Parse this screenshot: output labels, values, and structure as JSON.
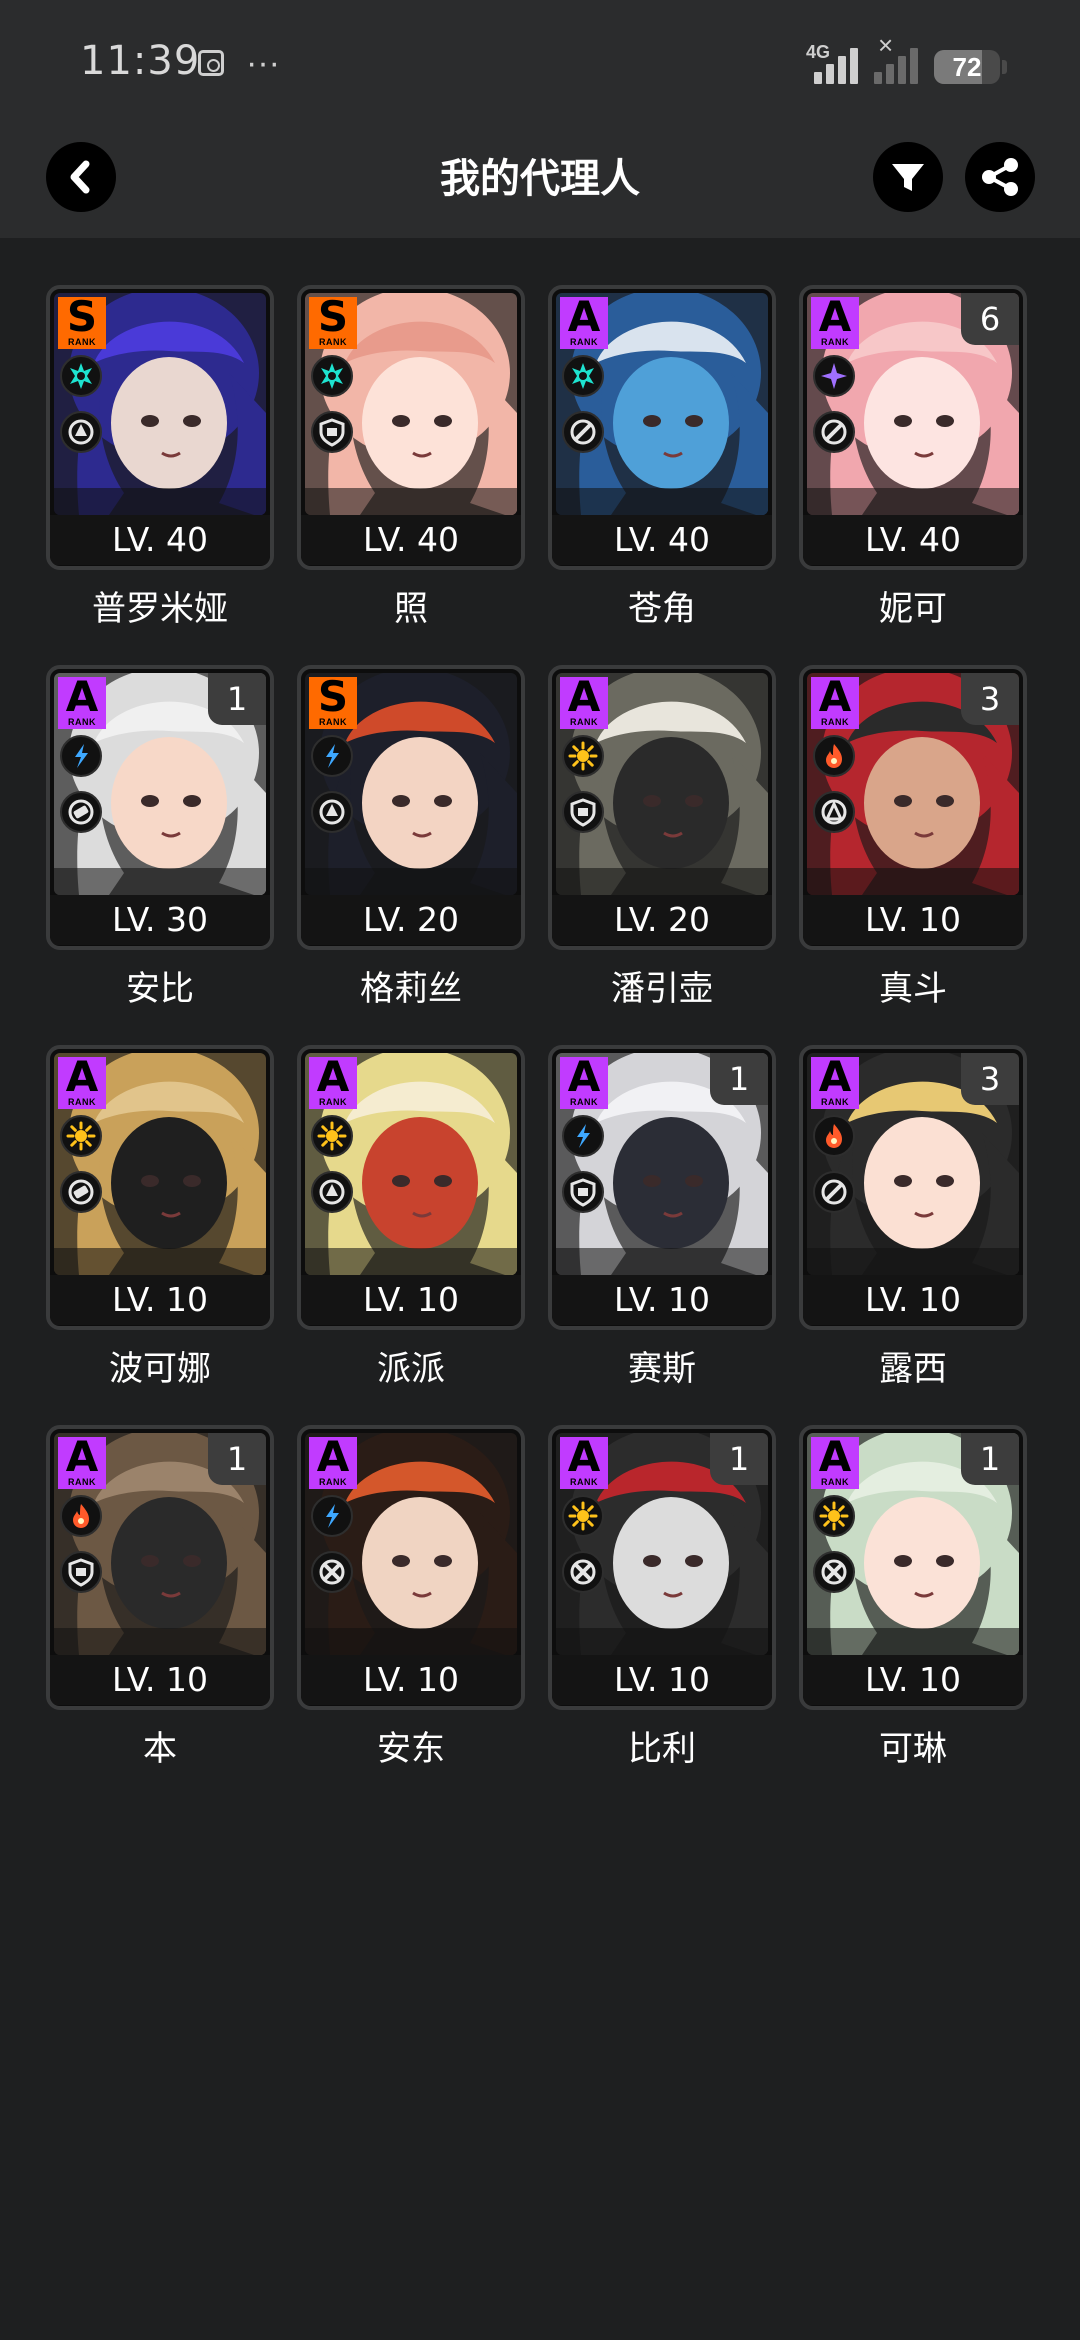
{
  "status_bar": {
    "time": "11:39",
    "dots": "···",
    "network": "4G",
    "battery": "72",
    "battery_level": 72
  },
  "header": {
    "title": "我的代理人",
    "back_icon": "chevron-left-icon",
    "filter_icon": "filter-icon",
    "share_icon": "share-icon"
  },
  "colors": {
    "rank_S": "#ff6a00",
    "rank_A": "#c13bff",
    "ether": "#1ee3d0",
    "electric": "#3ea8ff",
    "fire": "#ff5a2a",
    "physical": "#ffc21a",
    "ice": "#aef0ff",
    "special": "#a070ff"
  },
  "agents": [
    {
      "name": "普罗米娅",
      "level": "LV. 40",
      "rank": "S",
      "rank_sub": "RANK",
      "attribute": "ether",
      "role": "anomaly",
      "mindscape": "",
      "palette": [
        "#2d2a8f",
        "#4a3ad8",
        "#e9d7d0"
      ]
    },
    {
      "name": "照",
      "level": "LV. 40",
      "rank": "S",
      "rank_sub": "RANK",
      "attribute": "ether",
      "role": "defense",
      "mindscape": "",
      "palette": [
        "#f2b6a8",
        "#e89b8c",
        "#fde2d8"
      ]
    },
    {
      "name": "苍角",
      "level": "LV. 40",
      "rank": "A",
      "rank_sub": "RANK",
      "attribute": "ether",
      "role": "support",
      "mindscape": "",
      "palette": [
        "#2a5d9a",
        "#d9e3ee",
        "#4fa0d8"
      ]
    },
    {
      "name": "妮可",
      "level": "LV. 40",
      "rank": "A",
      "rank_sub": "RANK",
      "attribute": "special",
      "role": "support",
      "mindscape": "6",
      "palette": [
        "#f1a7ae",
        "#f7c7c8",
        "#fde4e1"
      ]
    },
    {
      "name": "安比",
      "level": "LV. 30",
      "rank": "A",
      "rank_sub": "RANK",
      "attribute": "electric",
      "role": "stun",
      "mindscape": "1",
      "palette": [
        "#dcdcdc",
        "#f0f0f0",
        "#f7d8c8"
      ]
    },
    {
      "name": "格莉丝",
      "level": "LV. 20",
      "rank": "S",
      "rank_sub": "RANK",
      "attribute": "electric",
      "role": "anomaly",
      "mindscape": "",
      "palette": [
        "#1d1f2a",
        "#cf4a2a",
        "#f3d4c3"
      ]
    },
    {
      "name": "潘引壶",
      "level": "LV. 20",
      "rank": "A",
      "rank_sub": "RANK",
      "attribute": "physical",
      "role": "defense",
      "mindscape": "",
      "palette": [
        "#6b6a60",
        "#e8e5dc",
        "#2a2a2a"
      ]
    },
    {
      "name": "真斗",
      "level": "LV. 10",
      "rank": "A",
      "rank_sub": "RANK",
      "attribute": "fire",
      "role": "rupture",
      "mindscape": "3",
      "palette": [
        "#b5262e",
        "#2a2a2a",
        "#d9a58a"
      ]
    },
    {
      "name": "波可娜",
      "level": "LV. 10",
      "rank": "A",
      "rank_sub": "RANK",
      "attribute": "physical",
      "role": "stun",
      "mindscape": "",
      "palette": [
        "#c9a15a",
        "#e1c48b",
        "#1f1f1f"
      ]
    },
    {
      "name": "派派",
      "level": "LV. 10",
      "rank": "A",
      "rank_sub": "RANK",
      "attribute": "physical",
      "role": "anomaly",
      "mindscape": "",
      "palette": [
        "#e6d98c",
        "#f5ecd0",
        "#c8432e"
      ]
    },
    {
      "name": "赛斯",
      "level": "LV. 10",
      "rank": "A",
      "rank_sub": "RANK",
      "attribute": "electric",
      "role": "defense",
      "mindscape": "1",
      "palette": [
        "#d4d4d8",
        "#f1f1f4",
        "#2b2d36"
      ]
    },
    {
      "name": "露西",
      "level": "LV. 10",
      "rank": "A",
      "rank_sub": "RANK",
      "attribute": "fire",
      "role": "support",
      "mindscape": "3",
      "palette": [
        "#2b2b2b",
        "#e7c873",
        "#fbe0d3"
      ]
    },
    {
      "name": "本",
      "level": "LV. 10",
      "rank": "A",
      "rank_sub": "RANK",
      "attribute": "fire",
      "role": "defense",
      "mindscape": "1",
      "palette": [
        "#6c5844",
        "#9b836b",
        "#2a2a2a"
      ]
    },
    {
      "name": "安东",
      "level": "LV. 10",
      "rank": "A",
      "rank_sub": "RANK",
      "attribute": "electric",
      "role": "attack",
      "mindscape": "",
      "palette": [
        "#2a1c16",
        "#d4572b",
        "#f0d4c2"
      ]
    },
    {
      "name": "比利",
      "level": "LV. 10",
      "rank": "A",
      "rank_sub": "RANK",
      "attribute": "physical",
      "role": "attack",
      "mindscape": "1",
      "palette": [
        "#2c2c2c",
        "#b9262c",
        "#dcdcdc"
      ]
    },
    {
      "name": "可琳",
      "level": "LV. 10",
      "rank": "A",
      "rank_sub": "RANK",
      "attribute": "physical",
      "role": "attack",
      "mindscape": "1",
      "palette": [
        "#c9dcc6",
        "#e4eee0",
        "#fbe2d7"
      ]
    }
  ]
}
